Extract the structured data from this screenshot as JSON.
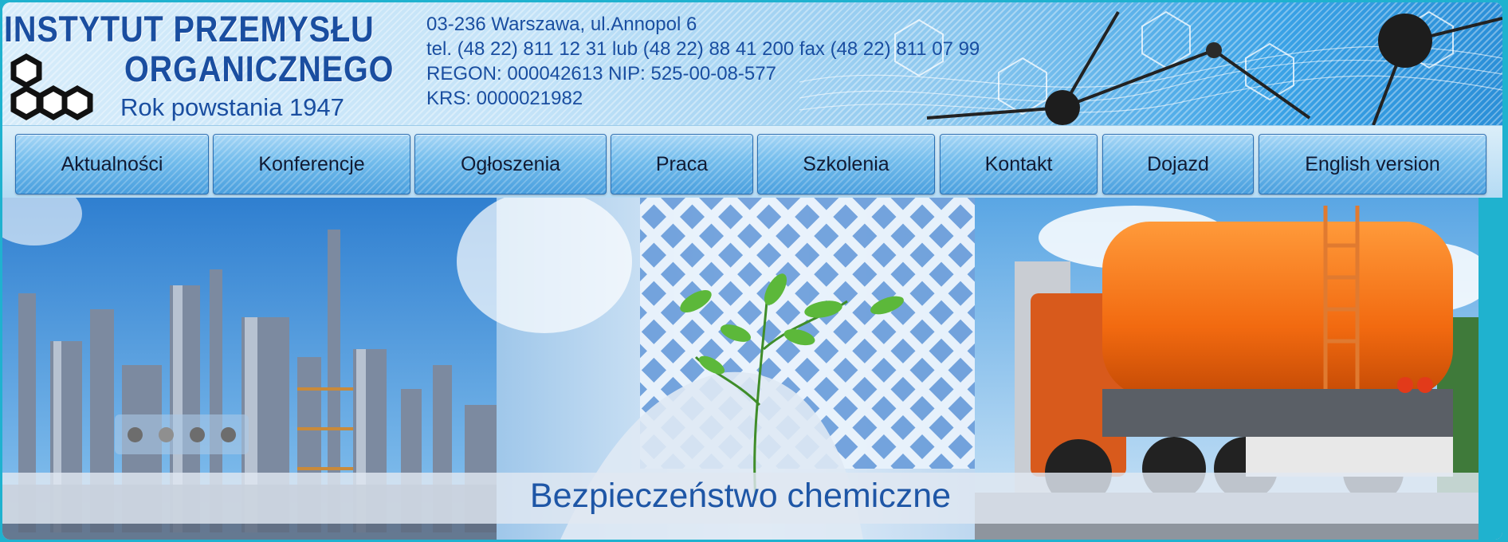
{
  "header": {
    "logo_line1": "INSTYTUT PRZEMYSŁU",
    "logo_line2": "ORGANICZNEGO",
    "logo_year": "Rok powstania  1947",
    "logo_mark": "IPO",
    "contact": {
      "address": "03-236 Warszawa, ul.Annopol 6",
      "phones": "tel. (48 22) 811 12 31 lub (48 22) 88 41 200 fax (48 22) 811 07 99",
      "regon_nip": "REGON: 000042613 NIP: 525-00-08-577",
      "krs": "KRS: 0000021982"
    },
    "colors": {
      "brand": "#1a4ea0"
    }
  },
  "nav": {
    "items": [
      {
        "label": "Aktualności"
      },
      {
        "label": "Konferencje"
      },
      {
        "label": "Ogłoszenia"
      },
      {
        "label": "Praca"
      },
      {
        "label": "Szkolenia"
      },
      {
        "label": "Kontakt"
      },
      {
        "label": "Dojazd"
      },
      {
        "label": "English version"
      }
    ]
  },
  "slider": {
    "caption": "Bezpieczeństwo chemiczne",
    "slide_count": 4,
    "active_dot_color": "#6d6d6d",
    "images": [
      "refinery",
      "plant-in-hand",
      "tanker-truck"
    ]
  }
}
